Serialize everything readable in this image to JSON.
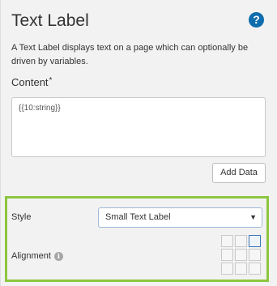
{
  "panel": {
    "title": "Text Label",
    "help_icon_glyph": "?",
    "description": "A Text Label displays text on a page which can optionally be driven by variables."
  },
  "content": {
    "label": "Content",
    "required_marker": "*",
    "value": "{{10:string}}"
  },
  "add_data_button": {
    "label": "Add Data"
  },
  "style": {
    "label": "Style",
    "selected_value": "Small Text Label",
    "caret_glyph": "▼"
  },
  "alignment": {
    "label": "Alignment",
    "info_icon_glyph": "i",
    "selected": "top-right",
    "cells": [
      "top-left",
      "top-center",
      "top-right",
      "middle-left",
      "middle-center",
      "middle-right",
      "bottom-left",
      "bottom-center",
      "bottom-right"
    ]
  },
  "colors": {
    "highlight_border": "#8dc63f",
    "help_icon": "#0f6dae",
    "selected_cell_border": "#3a76b5"
  },
  "icons": {
    "help": "help-icon",
    "info": "info-icon",
    "dropdown": "chevron-down-icon"
  }
}
